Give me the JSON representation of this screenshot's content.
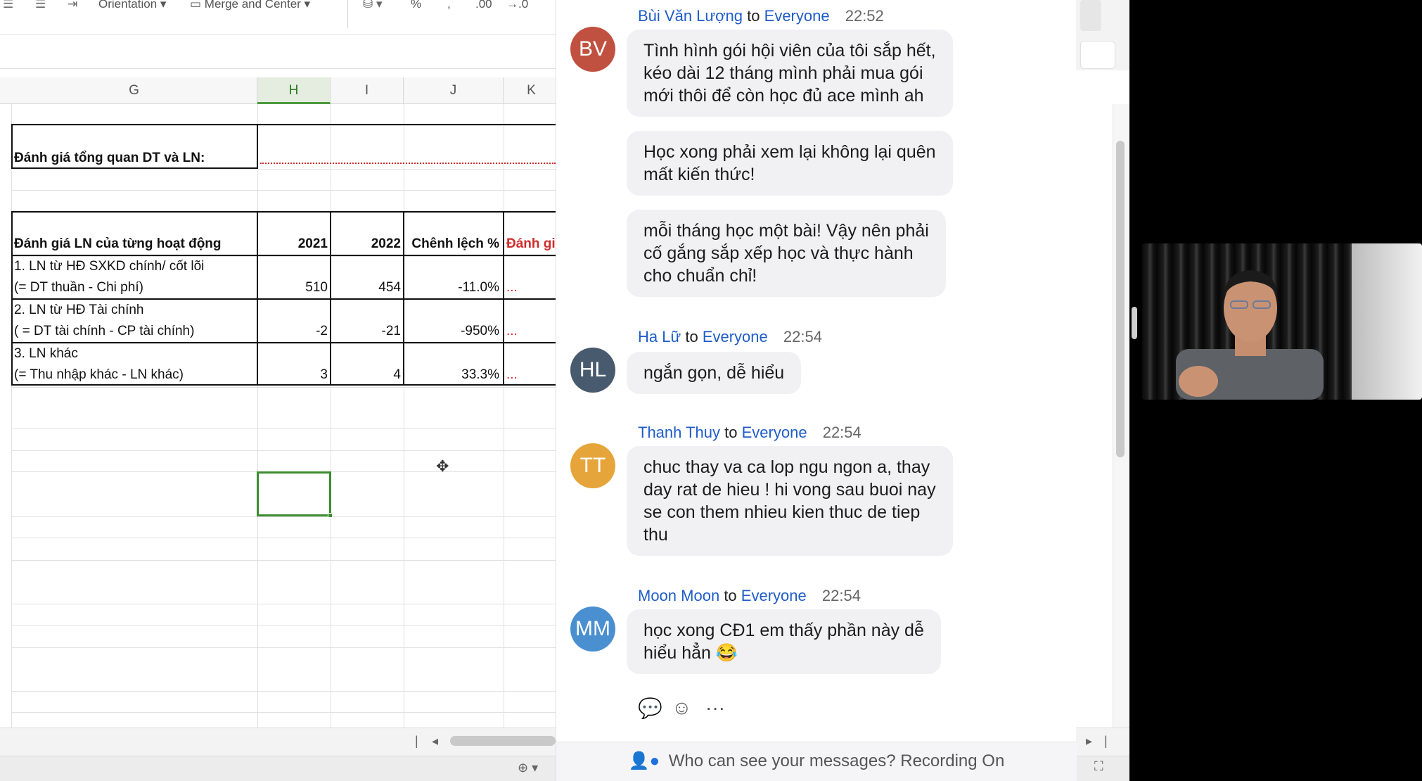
{
  "ribbon": {
    "orientation": "Orientation",
    "merge_center": "Merge and Center",
    "percent": "%",
    "comma": ",",
    "dec_increase": ".00",
    "dec_decrease": "→.0"
  },
  "columns": [
    "G",
    "H",
    "I",
    "J",
    "K"
  ],
  "sheet": {
    "overview_label": "Đánh giá tổng quan DT và LN:",
    "table_header": {
      "label": "Đánh giá LN của từng hoạt động",
      "y2021": "2021",
      "y2022": "2022",
      "diff": "Chênh lệch %",
      "eval": "Đánh gi"
    },
    "rows": [
      {
        "line1": "1. LN từ HĐ SXKD chính/ cốt lõi",
        "line2": "(= DT thuần - Chi phí)",
        "v2021": "510",
        "v2022": "454",
        "diff": "-11.0%",
        "eval": "..."
      },
      {
        "line1": "2. LN từ HĐ Tài chính",
        "line2": "( = DT tài chính - CP tài chính)",
        "v2021": "-2",
        "v2022": "-21",
        "diff": "-950%",
        "eval": "..."
      },
      {
        "line1": "3. LN khác",
        "line2": "(= Thu nhập khác - LN khác)",
        "v2021": "3",
        "v2022": "4",
        "diff": "33.3%",
        "eval": "..."
      }
    ]
  },
  "chat": {
    "messages": [
      {
        "sender": "Bùi Văn Lượng",
        "to": "to",
        "recipient": "Everyone",
        "time": "22:52",
        "initials": "BV",
        "avatar_color": "#c0503f",
        "bubbles": [
          [
            "Tình hình gói hội viên của tôi sắp hết,",
            "kéo dài 12 tháng mình phải mua gói",
            "mới thôi để còn học đủ ace mình ah"
          ],
          [
            "Học xong phải xem lại không lại quên",
            "mất kiến thức!"
          ],
          [
            "mỗi tháng học một bài! Vậy nên phải",
            "cố gắng sắp xếp học và thực hành",
            "cho chuẩn chỉ!"
          ]
        ]
      },
      {
        "sender": "Ha Lữ",
        "to": "to",
        "recipient": "Everyone",
        "time": "22:54",
        "initials": "HL",
        "avatar_color": "#485a6d",
        "bubbles": [
          [
            "ngắn gọn, dễ hiểu"
          ]
        ]
      },
      {
        "sender": "Thanh Thuy",
        "to": "to",
        "recipient": "Everyone",
        "time": "22:54",
        "initials": "TT",
        "avatar_color": "#e6a53a",
        "bubbles": [
          [
            "chuc thay va ca lop ngu ngon a, thay",
            "day rat de hieu ! hi vong sau buoi nay",
            "se con them nhieu kien thuc de tiep",
            "thu"
          ]
        ]
      },
      {
        "sender": "Moon Moon",
        "to": "to",
        "recipient": "Everyone",
        "time": "22:54",
        "initials": "MM",
        "avatar_color": "#4a8fcf",
        "bubbles": [
          [
            "học xong CĐ1 em thấy phần này dễ",
            "hiểu hẳn 😂"
          ]
        ]
      }
    ],
    "footer": "Who can see your messages? Recording On",
    "actions": {
      "reply": "reply-icon",
      "react": "emoji-icon",
      "more": "···"
    }
  }
}
